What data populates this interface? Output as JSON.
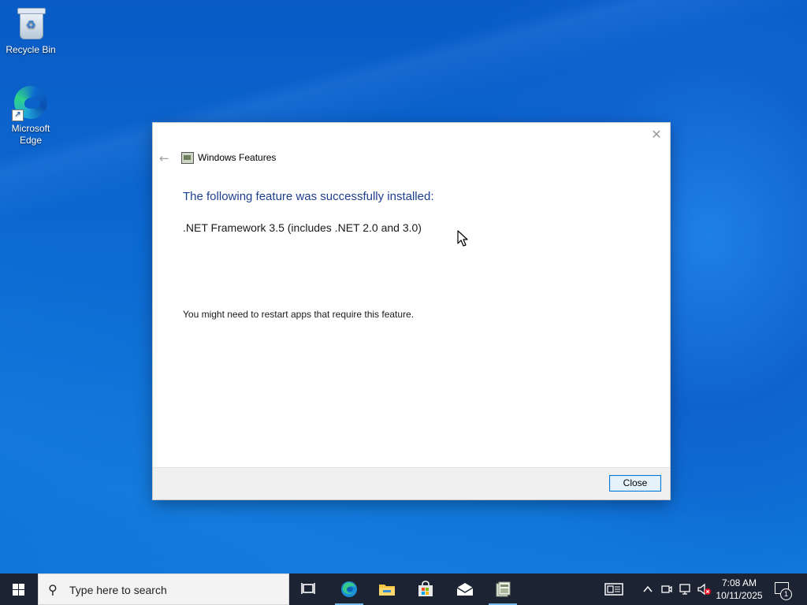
{
  "desktop": {
    "icons": [
      {
        "label": "Recycle Bin"
      },
      {
        "label": "Microsoft Edge"
      }
    ]
  },
  "dialog": {
    "title": "Windows Features",
    "heading": "The following feature was successfully installed:",
    "feature": ".NET Framework 3.5 (includes .NET 2.0 and 3.0)",
    "note": "You might need to restart apps that require this feature.",
    "close_button": "Close",
    "heading_color": "#1e3f8f",
    "button_border_color": "#0078d7"
  },
  "taskbar": {
    "search_placeholder": "Type here to search",
    "pinned": [
      "task-view-icon",
      "edge-icon",
      "file-explorer-icon",
      "store-icon",
      "mail-icon",
      "windows-features-icon"
    ],
    "clock_time": "7:08 AM",
    "clock_date": "10/11/2025",
    "notification_count": "1"
  }
}
